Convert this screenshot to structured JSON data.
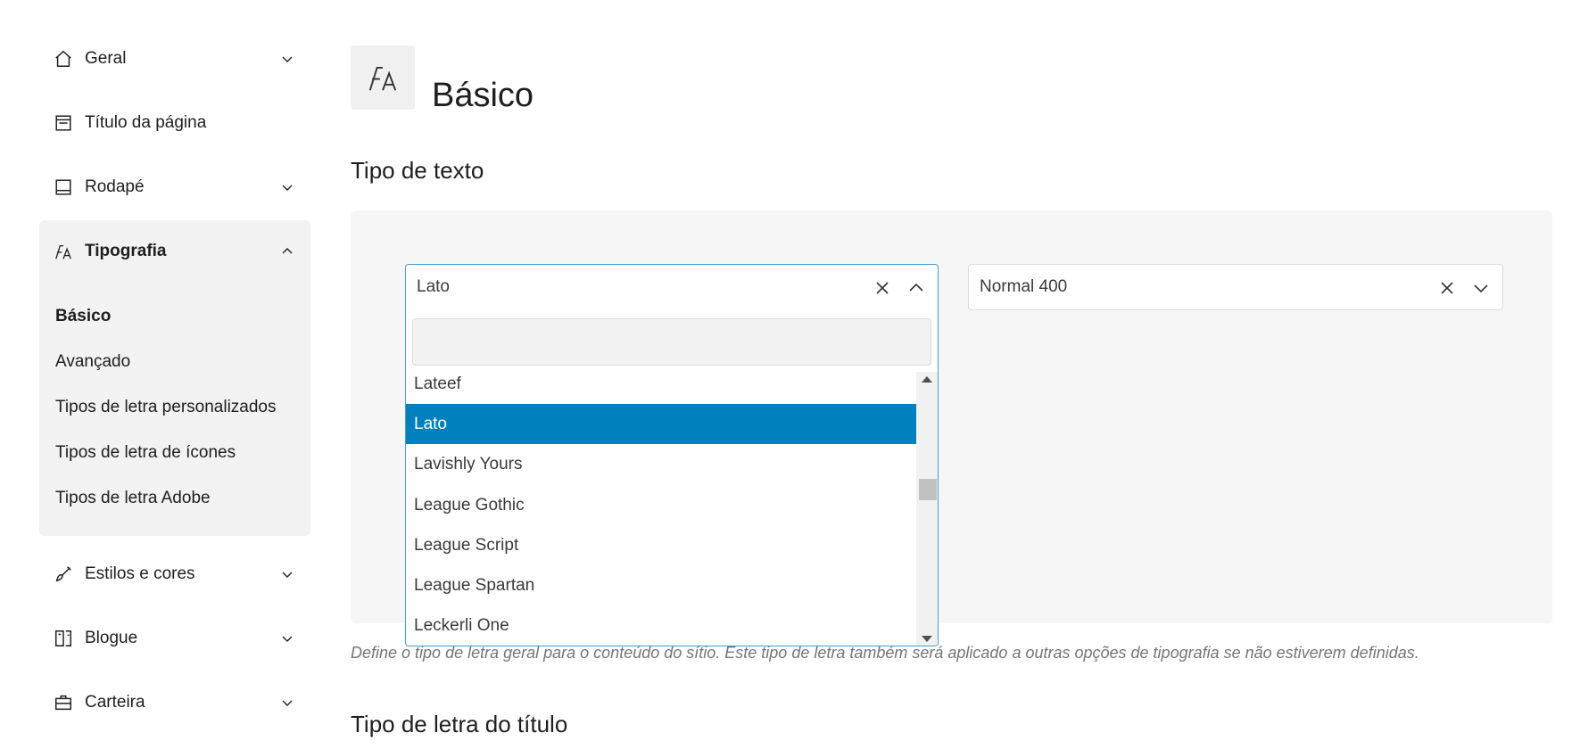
{
  "sidebar": {
    "items": [
      {
        "label": "Geral",
        "icon": "home-icon",
        "expanded": false
      },
      {
        "label": "Título da página",
        "icon": "page-title-icon"
      },
      {
        "label": "Rodapé",
        "icon": "footer-icon",
        "expanded": false
      },
      {
        "label": "Tipografia",
        "icon": "typography-icon",
        "expanded": true
      },
      {
        "label": "Estilos e cores",
        "icon": "brush-icon",
        "expanded": false
      },
      {
        "label": "Blogue",
        "icon": "blog-icon",
        "expanded": false
      },
      {
        "label": "Carteira",
        "icon": "briefcase-icon",
        "expanded": false
      }
    ],
    "typography_sub": [
      {
        "label": "Básico",
        "active": true
      },
      {
        "label": "Avançado"
      },
      {
        "label": "Tipos de letra personalizados"
      },
      {
        "label": "Tipos de letra de ícones"
      },
      {
        "label": "Tipos de letra Adobe"
      }
    ]
  },
  "main": {
    "title": "Básico",
    "section_font": "Tipo de texto",
    "section_heading": "Tipo de letra do título",
    "font_select": {
      "value": "Lato",
      "search_placeholder": ""
    },
    "weight_select": {
      "value": "Normal 400"
    },
    "dropdown_options": [
      "Lateef",
      "Lato",
      "Lavishly Yours",
      "League Gothic",
      "League Script",
      "League Spartan",
      "Leckerli One"
    ],
    "selected_option": "Lato",
    "description": "Define o tipo de letra geral para o conteúdo do sítio. Este tipo de letra também será aplicado a outras opções de tipografia se não estiverem definidas."
  },
  "colors": {
    "accent": "#0080bd",
    "panel_bg": "#f6f6f6",
    "sidebar_active_bg": "#f2f2f2"
  }
}
